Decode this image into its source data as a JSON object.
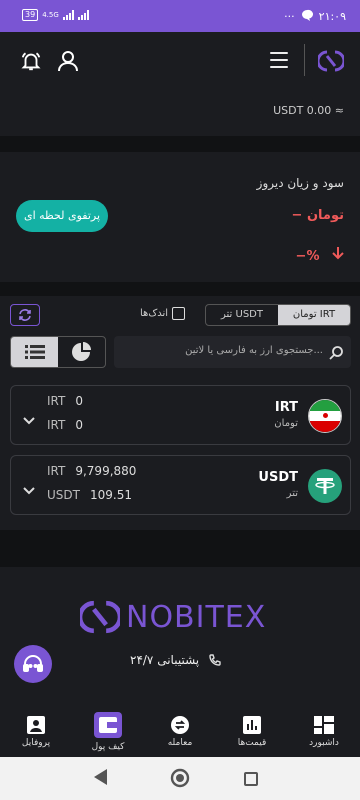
{
  "status": {
    "battery": "39",
    "network": "4.5G",
    "time": "۲۱:۰۹",
    "dots": "···"
  },
  "card1": {
    "value": "USDT 0.00 ≈"
  },
  "pnl": {
    "title": "سود و زیان دیروز",
    "currency": "− تومان",
    "percent": "−%",
    "button": "پرتفوی لحظه ای"
  },
  "market": {
    "tabs": [
      "تومان IRT",
      "تتر USDT"
    ],
    "active_tab": 0,
    "small_label": "اندک‌ها",
    "search_placeholder": "جستجوی ارز به فارسی یا لاتین..."
  },
  "assets": [
    {
      "symbol": "IRT",
      "name": "تومان",
      "lines": [
        {
          "unit": "IRT",
          "value": "0"
        },
        {
          "unit": "IRT",
          "value": "0"
        }
      ]
    },
    {
      "symbol": "USDT",
      "name": "تتر",
      "lines": [
        {
          "unit": "IRT",
          "value": "9,799,880"
        },
        {
          "unit": "USDT",
          "value": "109.51"
        }
      ]
    }
  ],
  "footer": {
    "brand": "NOBITEX",
    "support": "پشتیبانی ۲۴/۷"
  },
  "nav": [
    {
      "label": "داشبورد",
      "icon": "dashboard-icon"
    },
    {
      "label": "قیمت‌ها",
      "icon": "chart-icon"
    },
    {
      "label": "معامله",
      "icon": "trade-icon"
    },
    {
      "label": "کیف پول",
      "icon": "wallet-icon"
    },
    {
      "label": "پروفایل",
      "icon": "profile-icon"
    }
  ],
  "colors": {
    "brand": "#7a55d3",
    "teal": "#14b1a4",
    "loss": "#ef5a5a"
  }
}
